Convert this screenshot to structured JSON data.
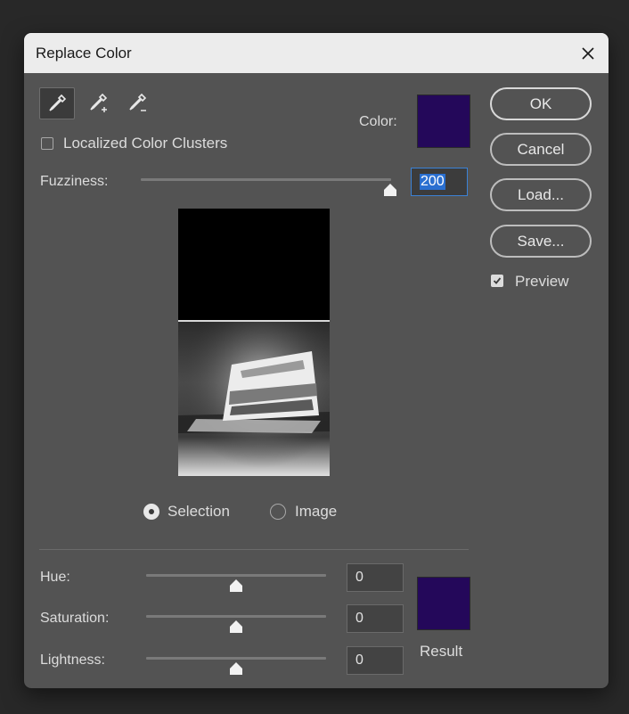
{
  "dialog": {
    "title": "Replace Color",
    "close_icon": "close-icon"
  },
  "tools": [
    {
      "name": "eyedropper-tool",
      "icon": "eyedropper-icon",
      "active": true
    },
    {
      "name": "eyedropper-plus-tool",
      "icon": "eyedropper-plus-icon",
      "active": false
    },
    {
      "name": "eyedropper-minus-tool",
      "icon": "eyedropper-minus-icon",
      "active": false
    }
  ],
  "localized_clusters": {
    "label": "Localized Color Clusters",
    "checked": false
  },
  "color": {
    "label": "Color:",
    "value": "#24085a"
  },
  "fuzziness": {
    "label": "Fuzziness:",
    "value": "200",
    "slider_fraction": 1.0
  },
  "view_mode": {
    "options": [
      "Selection",
      "Image"
    ],
    "selected": "Selection"
  },
  "adjustments": {
    "hue": {
      "label": "Hue:",
      "value": "0"
    },
    "saturation": {
      "label": "Saturation:",
      "value": "0"
    },
    "lightness": {
      "label": "Lightness:",
      "value": "0"
    }
  },
  "result": {
    "label": "Result",
    "color": "#24085a"
  },
  "buttons": {
    "ok": "OK",
    "cancel": "Cancel",
    "load": "Load...",
    "save": "Save..."
  },
  "preview": {
    "label": "Preview",
    "checked": true
  }
}
